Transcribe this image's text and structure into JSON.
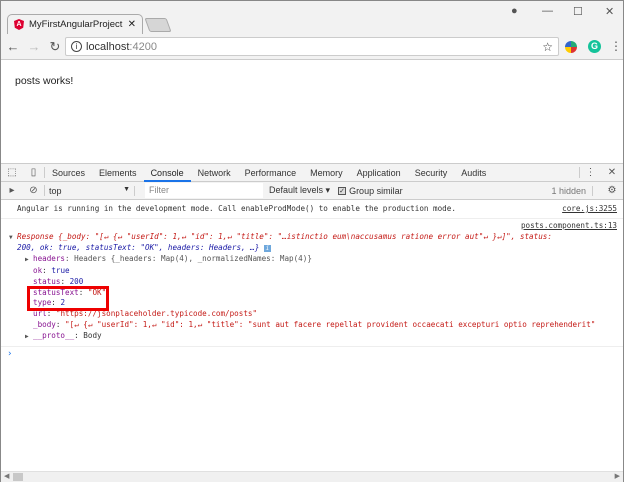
{
  "browser": {
    "tab_title": "MyFirstAngularProject",
    "url_host": "localhost",
    "url_port": ":4200"
  },
  "page": {
    "text": "posts works!"
  },
  "devtools": {
    "tabs": [
      "Sources",
      "Elements",
      "Console",
      "Network",
      "Performance",
      "Memory",
      "Application",
      "Security",
      "Audits"
    ],
    "active_tab": "Console",
    "context": "top",
    "filter_placeholder": "Filter",
    "levels": "Default levels",
    "group_similar": "Group similar",
    "hidden_count": "1 hidden"
  },
  "console": {
    "msg1": {
      "text": "Angular is running in the development mode. Call enableProdMode() to enable the production mode.",
      "source": "core.js:3255"
    },
    "msg2": {
      "source": "posts.component.ts:13",
      "summary1": "Response {_body: \"[↵  {↵    \"userId\": 1,↵    \"id\": 1,↵    \"title\": \"…istinctio eum\\naccusamus ratione error aut\"↵  }↵]\", status:",
      "summary2": "200, ok: true, statusText: \"OK\", headers: Headers, …}",
      "headers_key": "headers",
      "headers_val": ": Headers {_headers: Map(4), _normalizedNames: Map(4)}",
      "ok_key": "ok",
      "ok_val": "true",
      "status_key": "status",
      "status_val": "200",
      "statusText_key": "statusText",
      "statusText_val": "\"OK\"",
      "type_key": "type",
      "type_val": "2",
      "url_key": "url",
      "url_val": "\"https://jsonplaceholder.typicode.com/posts\"",
      "body_key": "_body",
      "body_val": "\"[↵  {↵    \"userId\": 1,↵    \"id\": 1,↵    \"title\": \"sunt aut facere repellat provident occaecati excepturi optio reprehenderit\"",
      "proto_key": "__proto__",
      "proto_val": ": Body"
    }
  }
}
